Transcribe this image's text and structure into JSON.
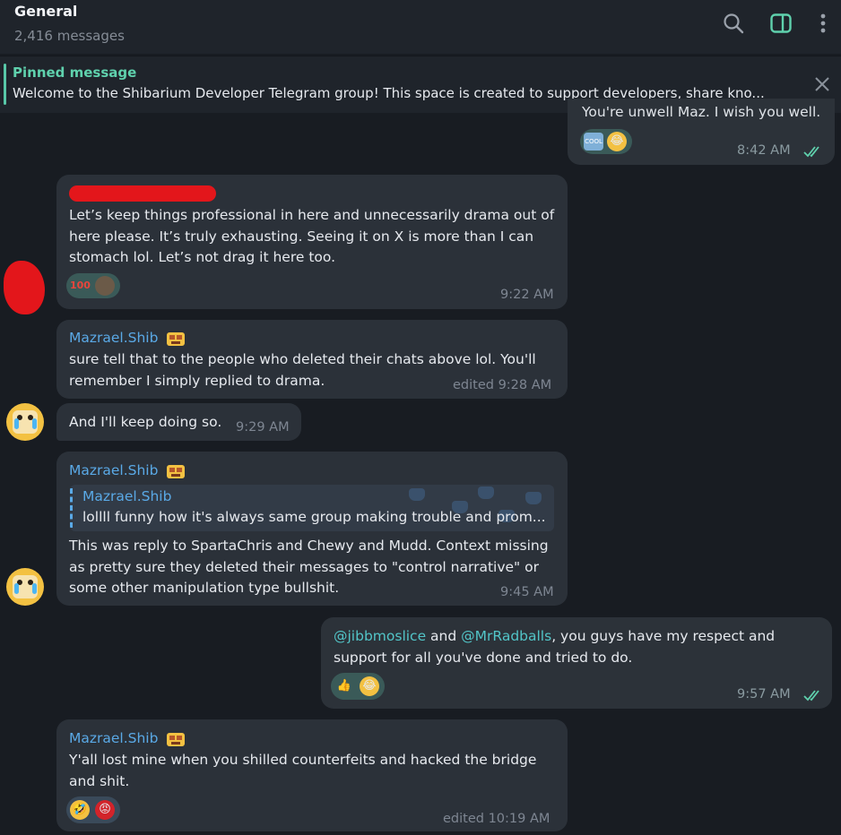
{
  "header": {
    "title": "General",
    "subtitle": "2,416 messages",
    "icons": [
      "search-icon",
      "sidebar-toggle-icon",
      "more-vertical-icon"
    ]
  },
  "pinned": {
    "label": "Pinned message",
    "text": "Welcome to the Shibarium Developer Telegram group! This space is created to support developers, share kno..."
  },
  "colors": {
    "background": "#181c22",
    "bubble": "#2b3139",
    "accent": "#5fd1ad",
    "sender": "#5aa9e6",
    "mention": "#52c5c8",
    "redaction": "#e3161b"
  },
  "messages": [
    {
      "id": "m0",
      "outgoing": true,
      "text": "You're unwell Maz. I wish you well.",
      "time": "8:42 AM",
      "reactions": [
        "cool-emoji",
        "crying-face-emoji"
      ]
    },
    {
      "id": "m1",
      "outgoing": false,
      "sender_redacted": true,
      "lines": [
        "Let’s keep things professional in here and unnecessarily drama out of",
        "here please.  It’s truly exhausting.  Seeing it on X is more than I can",
        "stomach lol.  Let’s not drag it here too."
      ],
      "time": "9:22 AM",
      "reactions": [
        "hundred-points-emoji",
        "avatar-reaction"
      ]
    },
    {
      "id": "m2",
      "outgoing": false,
      "sender": "Mazrael.Shib",
      "lines": [
        "sure tell that to the people who deleted their chats above lol. You'll",
        "remember I simply replied to drama."
      ],
      "time": "edited 9:28 AM"
    },
    {
      "id": "m3",
      "outgoing": false,
      "text": "And I'll keep doing so.",
      "time": "9:29 AM"
    },
    {
      "id": "m4",
      "outgoing": false,
      "sender": "Mazrael.Shib",
      "reply": {
        "sender": "Mazrael.Shib",
        "text": "lollll funny how it's always same group making trouble and prom..."
      },
      "lines": [
        "This was reply to SpartaChris and Chewy and Mudd. Context missing",
        "as pretty sure they deleted their messages to \"control narrative\" or",
        "some other manipulation type bullshit."
      ],
      "time": "9:45 AM"
    },
    {
      "id": "m5",
      "outgoing": true,
      "mention1": "@jibbmoslice",
      "and": " and ",
      "mention2": "@MrRadballs",
      "line1_rest": ", you guys have my respect and",
      "line2": "support for all you've done and tried to do.",
      "time": "9:57 AM",
      "reactions": [
        "thumbs-up-emoji",
        "crying-face-emoji"
      ]
    },
    {
      "id": "m6",
      "outgoing": false,
      "sender": "Mazrael.Shib",
      "lines": [
        "Y'all lost mine when you shilled counterfeits and hacked the bridge",
        "and shit."
      ],
      "time": "edited 10:19 AM",
      "reactions": [
        "rolling-laughing-emoji",
        "angry-face-emoji"
      ]
    }
  ]
}
